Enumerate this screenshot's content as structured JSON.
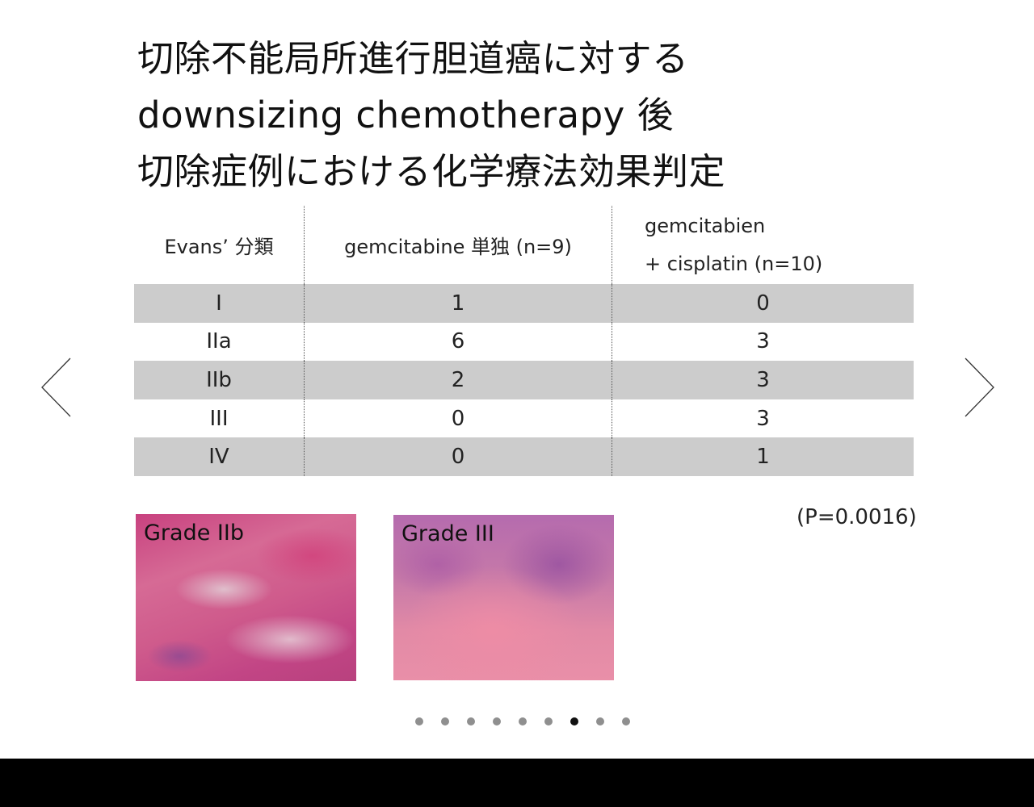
{
  "title": {
    "line1": "切除不能局所進行胆道癌に対する",
    "line2": "downsizing chemotherapy 後",
    "line3": "切除症例における化学療法効果判定"
  },
  "table": {
    "headers": {
      "col0": "Evans’ 分類",
      "col1": "gemcitabine 単独 (n=9)",
      "col2_line1": "gemcitabien",
      "col2_line2": "+ cisplatin (n=10)"
    },
    "rows": [
      {
        "grade": "I",
        "gem": "1",
        "gem_cis": "0"
      },
      {
        "grade": "IIa",
        "gem": "6",
        "gem_cis": "3"
      },
      {
        "grade": "IIb",
        "gem": "2",
        "gem_cis": "3"
      },
      {
        "grade": "III",
        "gem": "0",
        "gem_cis": "3"
      },
      {
        "grade": "IV",
        "gem": "0",
        "gem_cis": "1"
      }
    ]
  },
  "p_value": "(P=0.0016)",
  "images": {
    "left_label": "Grade IIb",
    "right_label": "Grade III"
  },
  "navigation": {
    "prev_icon": "chevron-left-icon",
    "next_icon": "chevron-right-icon",
    "dot_count": 9,
    "active_index": 6
  },
  "colors": {
    "row_shade": "#cccccc",
    "dot_inactive": "#8f8f8f",
    "dot_active": "#111111",
    "bottom_bar": "#000000"
  }
}
